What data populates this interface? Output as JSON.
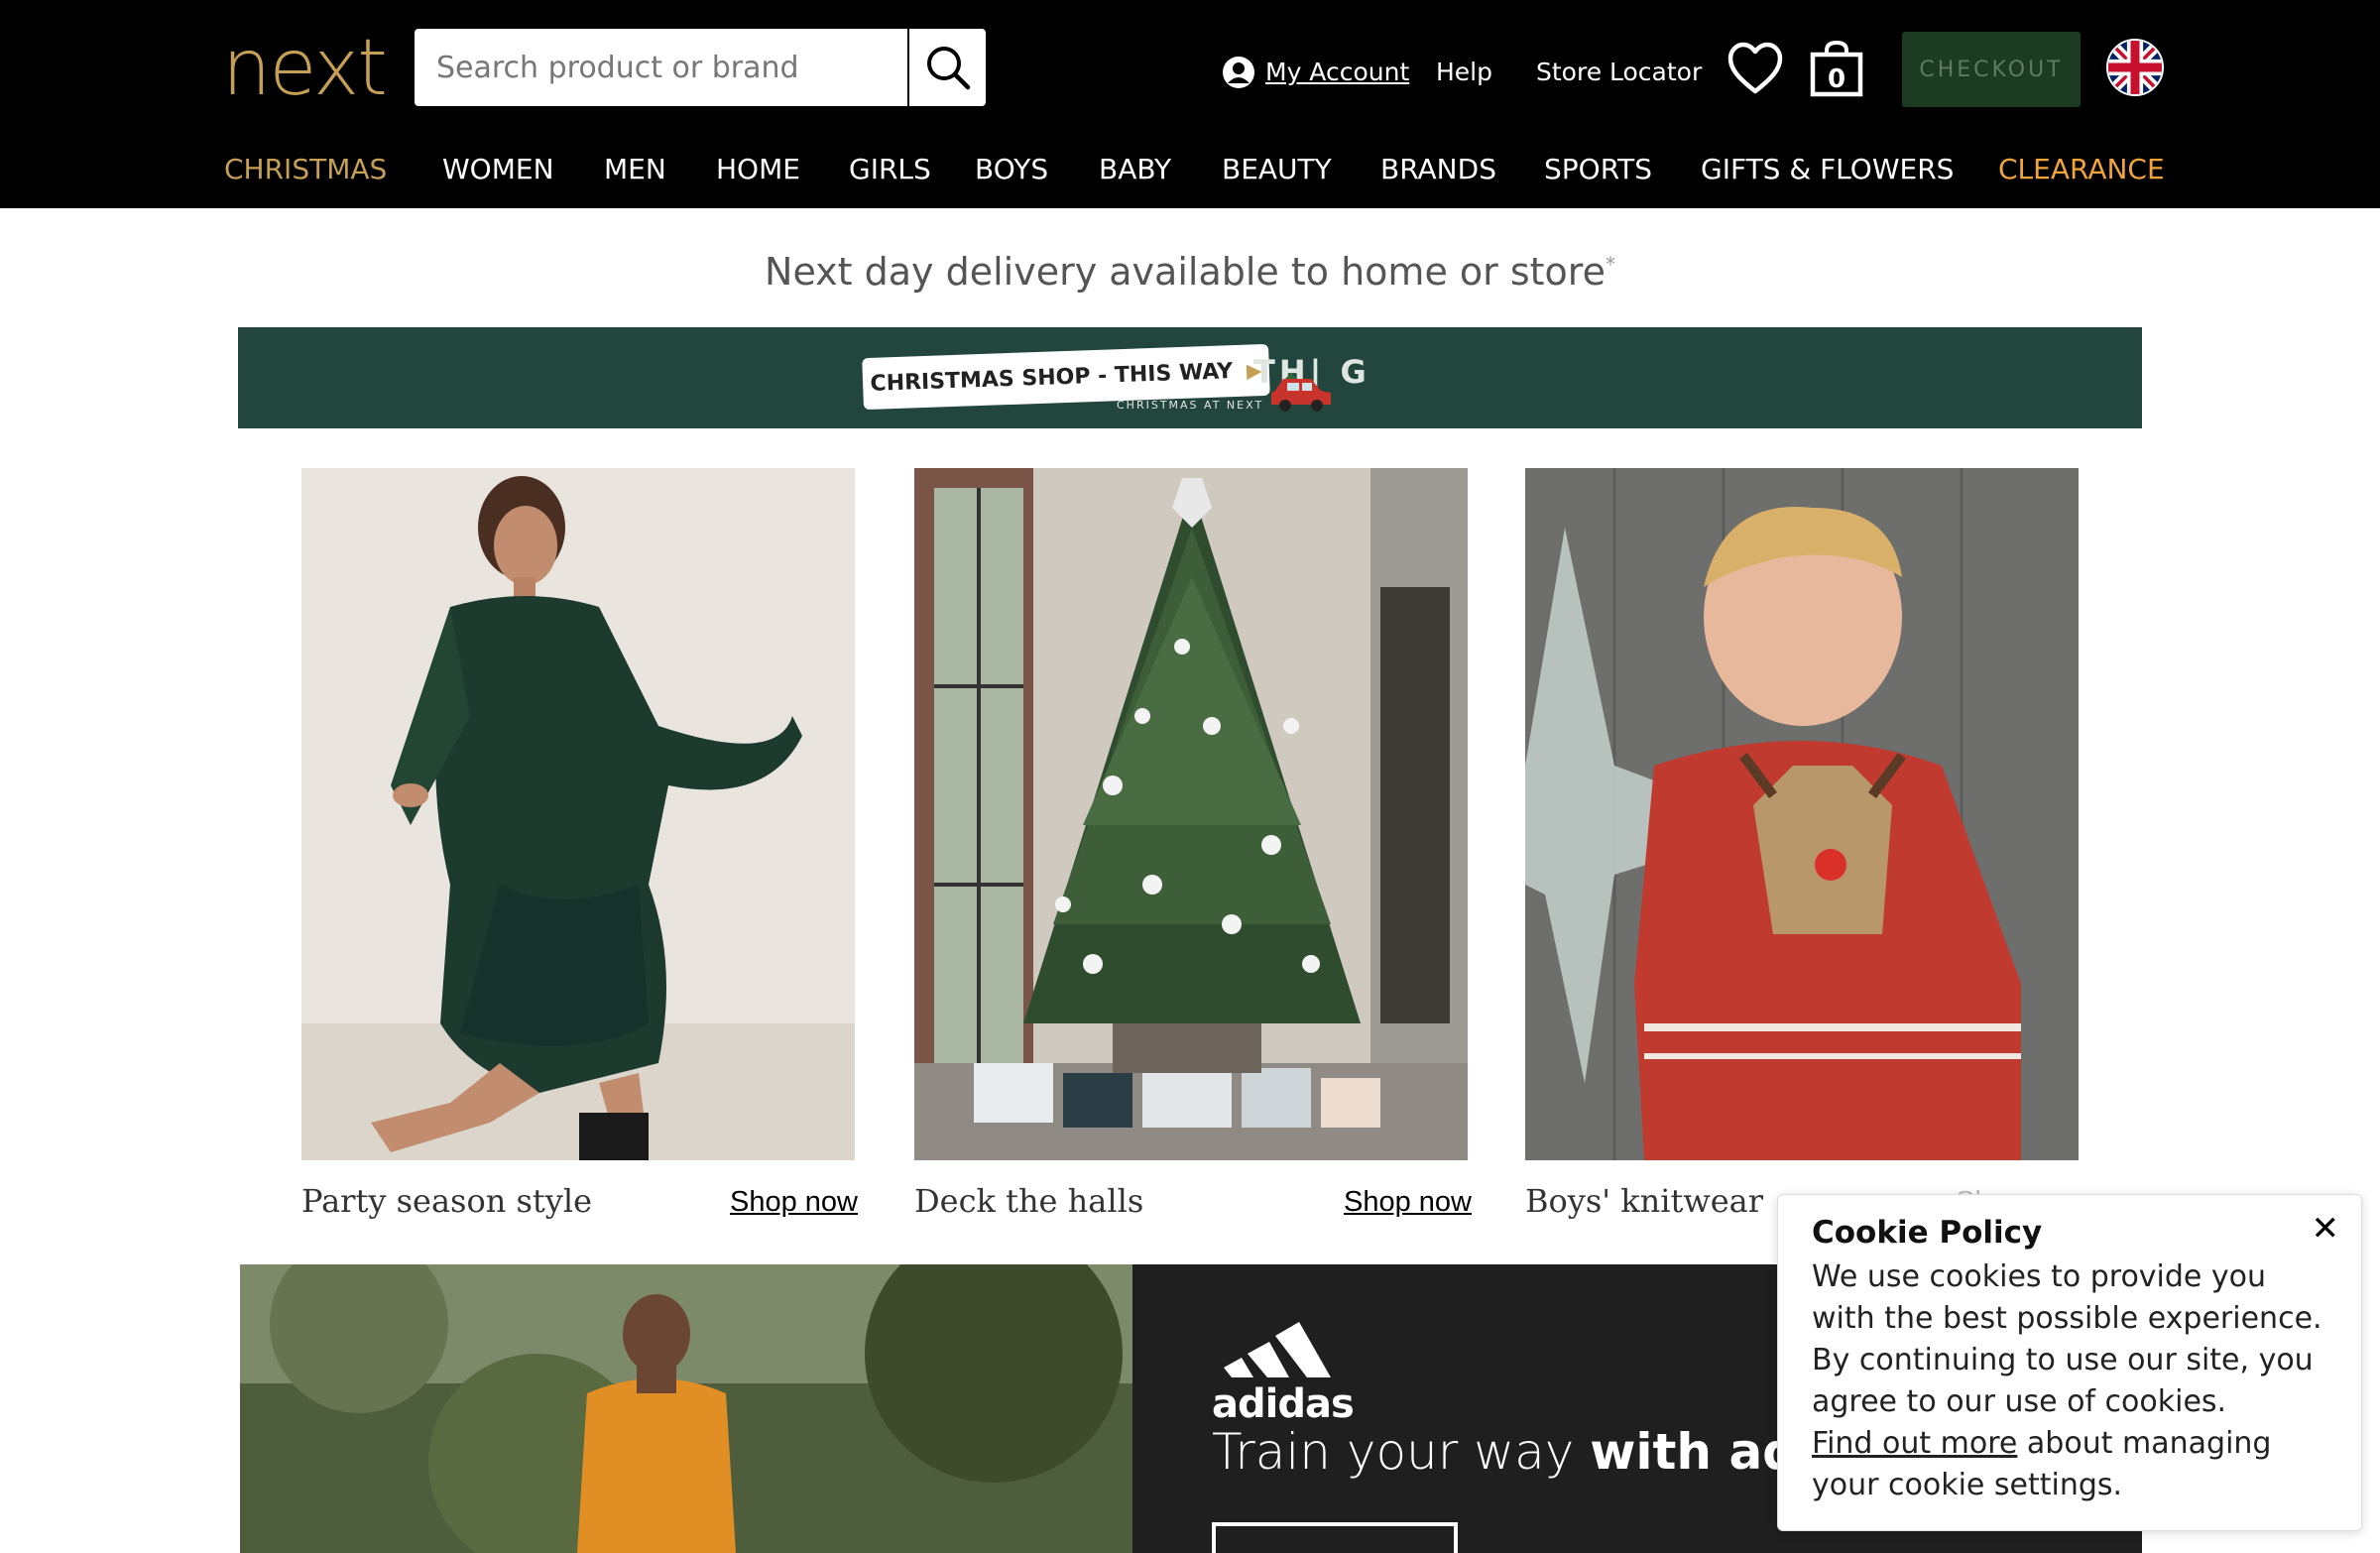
{
  "header": {
    "logo": "next",
    "search_placeholder": "Search product or brand",
    "my_account": "My Account",
    "help": "Help",
    "store_locator": "Store Locator",
    "bag_count": "0",
    "checkout": "CHECKOUT"
  },
  "nav": [
    {
      "label": "CHRISTMAS",
      "color": "#c49f55"
    },
    {
      "label": "WOMEN",
      "color": "#ffffff"
    },
    {
      "label": "MEN",
      "color": "#ffffff"
    },
    {
      "label": "HOME",
      "color": "#ffffff"
    },
    {
      "label": "GIRLS",
      "color": "#ffffff"
    },
    {
      "label": "BOYS",
      "color": "#ffffff"
    },
    {
      "label": "BABY",
      "color": "#ffffff"
    },
    {
      "label": "BEAUTY",
      "color": "#ffffff"
    },
    {
      "label": "BRANDS",
      "color": "#ffffff"
    },
    {
      "label": "SPORTS",
      "color": "#ffffff"
    },
    {
      "label": "GIFTS & FLOWERS",
      "color": "#ffffff"
    },
    {
      "label": "CLEARANCE",
      "color": "#f2a33a"
    }
  ],
  "promo": {
    "delivery": "Next day delivery available to home or store",
    "asterisk": "*",
    "banner_label": "CHRISTMAS SHOP - THIS WAY",
    "banner_sub": "CHRISTMAS AT NEXT",
    "banner_thing": "TH|  G"
  },
  "tiles": [
    {
      "caption": "Party season style",
      "link": "Shop now"
    },
    {
      "caption": "Deck the halls",
      "link": "Shop now"
    },
    {
      "caption": "Boys' knitwear",
      "link": "Shop now"
    }
  ],
  "adidas": {
    "brand": "adidas",
    "headline_light": "Train your way ",
    "headline_bold": "with adidas"
  },
  "cookie": {
    "title": "Cookie Policy",
    "body": "We use cookies to provide you with the best possible experience. By continuing to use our site, you agree to our use of cookies.",
    "link": "Find out more",
    "body_after": " about managing your cookie settings.",
    "close": "✕"
  },
  "colors": {
    "brand_gold": "#c49f55",
    "clearance_orange": "#f2a33a",
    "checkout_green": "#1c3b22",
    "banner_green": "#22463e"
  }
}
